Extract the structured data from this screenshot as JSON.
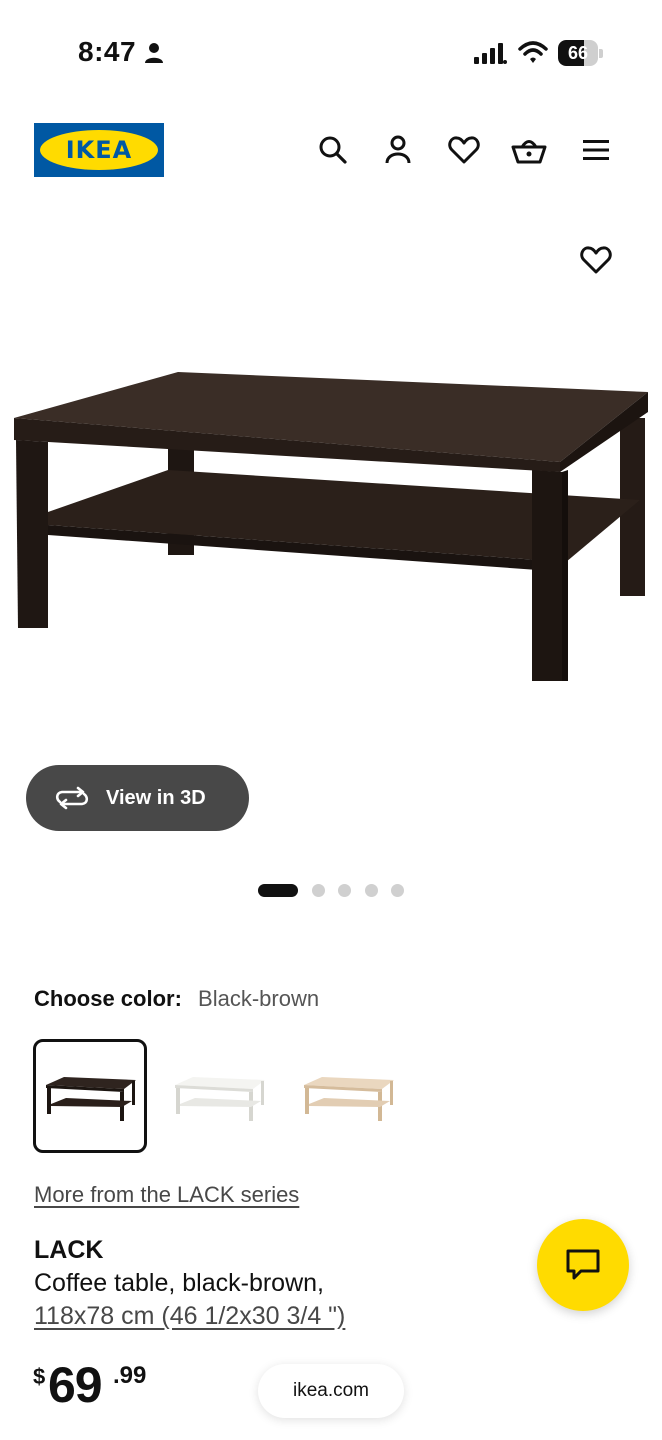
{
  "status_bar": {
    "time": "8:47",
    "battery_percent": 66,
    "battery_label": "66"
  },
  "header": {
    "logo_text": "IKEA",
    "brand_colors": {
      "blue": "#0058a3",
      "yellow": "#ffdb00"
    },
    "icons": [
      "search-icon",
      "account-icon",
      "heart-icon",
      "basket-icon",
      "menu-icon"
    ]
  },
  "gallery": {
    "view_3d_label": "View in 3D",
    "image_count": 5,
    "active_index": 0
  },
  "color_picker": {
    "label": "Choose color:",
    "selected_value": "Black-brown",
    "swatch_colors": [
      "#2a1f1a",
      "#f2f2ef",
      "#e2cdb3"
    ]
  },
  "series_link": "More from the LACK series",
  "product": {
    "name": "LACK",
    "description": "Coffee table, black-brown,",
    "dimensions": "118x78 cm (46 1/2x30 3/4 \")"
  },
  "price": {
    "currency": "$",
    "integer": "69",
    "decimal": ".99"
  },
  "url_bar": {
    "domain": "ikea.com"
  }
}
